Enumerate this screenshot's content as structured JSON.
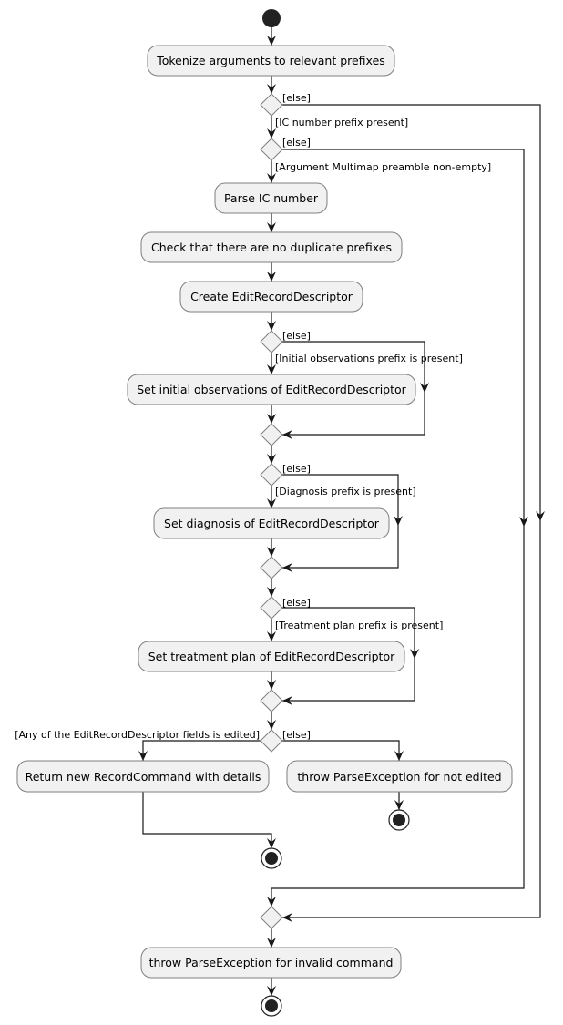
{
  "diagram": {
    "type": "activity",
    "actions": {
      "tokenize": "Tokenize arguments to relevant prefixes",
      "parse_ic": "Parse IC number",
      "check_duplicates": "Check that there are no duplicate prefixes",
      "create_descriptor": "Create EditRecordDescriptor",
      "set_initial_obs": "Set initial observations of EditRecordDescriptor",
      "set_diagnosis": "Set diagnosis of EditRecordDescriptor",
      "set_treatment": "Set treatment plan of EditRecordDescriptor",
      "return_command": "Return new RecordCommand with details",
      "throw_not_edited": "throw ParseException for not edited",
      "throw_invalid": "throw ParseException for invalid command"
    },
    "guards": {
      "ic_else": "[else]",
      "ic_present": "[IC number prefix present]",
      "preamble_else": "[else]",
      "preamble_nonempty": "[Argument Multimap preamble non-empty]",
      "initobs_else": "[else]",
      "initobs_present": "[Initial observations prefix is present]",
      "diag_else": "[else]",
      "diag_present": "[Diagnosis prefix is present]",
      "treat_else": "[else]",
      "treat_present": "[Treatment plan prefix is present]",
      "edited_yes": "[Any of the EditRecordDescriptor fields is edited]",
      "edited_else": "[else]"
    },
    "colors": {
      "node_fill": "#F1F1F1",
      "node_stroke": "#7F7F7F",
      "edge": "#181818",
      "terminal": "#222222"
    }
  }
}
